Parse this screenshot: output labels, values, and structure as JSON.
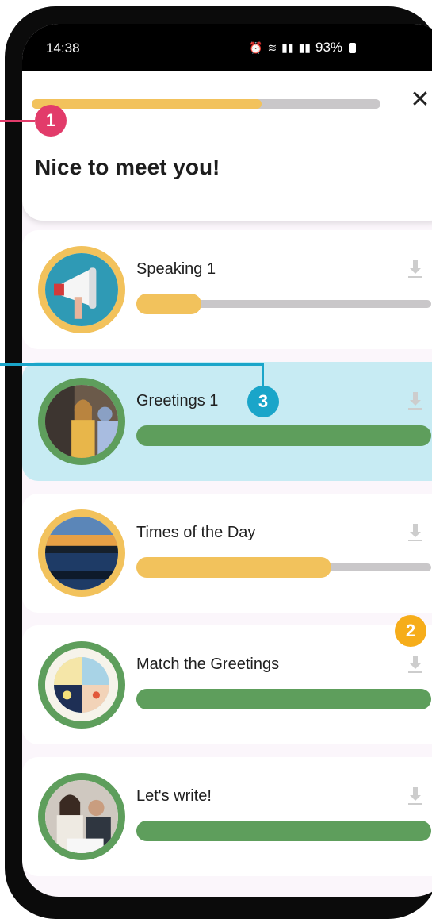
{
  "status_bar": {
    "time": "14:38",
    "battery": "93%"
  },
  "header": {
    "title": "Nice to meet you!",
    "progress": 0.66
  },
  "lessons": [
    {
      "title": "Speaking 1",
      "progress": 0.22,
      "color": "#f2c25c"
    },
    {
      "title": "Greetings 1",
      "progress": 1.0,
      "color": "#5e9e5c",
      "active": true
    },
    {
      "title": "Times of the Day",
      "progress": 0.66,
      "color": "#f2c25c"
    },
    {
      "title": "Match the Greetings",
      "progress": 1.0,
      "color": "#5e9e5c"
    },
    {
      "title": "Let's write!",
      "progress": 1.0,
      "color": "#5e9e5c"
    }
  ],
  "callouts": [
    {
      "label": "1",
      "color": "#e23b6a"
    },
    {
      "label": "2",
      "color": "#f6ad1a"
    },
    {
      "label": "3",
      "color": "#1aa5c9"
    }
  ],
  "icons": [
    "close-icon",
    "download-icon",
    "alarm-icon",
    "wifi-icon",
    "signal-icon",
    "battery-icon"
  ]
}
